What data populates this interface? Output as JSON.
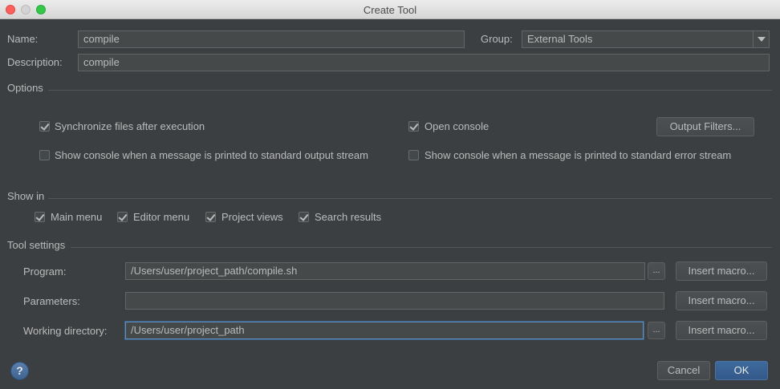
{
  "window": {
    "title": "Create Tool"
  },
  "form": {
    "name_label": "Name:",
    "name_value": "compile",
    "group_label": "Group:",
    "group_value": "External Tools",
    "description_label": "Description:",
    "description_value": "compile"
  },
  "options": {
    "title": "Options",
    "sync_files": {
      "label": "Synchronize files after execution",
      "checked": true
    },
    "open_console": {
      "label": "Open console",
      "checked": true
    },
    "output_filters_label": "Output Filters...",
    "show_console_stdout": {
      "label": "Show console when a message is printed to standard output stream",
      "checked": false
    },
    "show_console_stderr": {
      "label": "Show console when a message is printed to standard error stream",
      "checked": false
    }
  },
  "show_in": {
    "title": "Show in",
    "main_menu": {
      "label": "Main menu",
      "checked": true
    },
    "editor_menu": {
      "label": "Editor menu",
      "checked": true
    },
    "project_views": {
      "label": "Project views",
      "checked": true
    },
    "search_results": {
      "label": "Search results",
      "checked": true
    }
  },
  "tool_settings": {
    "title": "Tool settings",
    "program_label": "Program:",
    "program_value": "/Users/user/project_path/compile.sh",
    "parameters_label": "Parameters:",
    "parameters_value": "",
    "working_dir_label": "Working directory:",
    "working_dir_value": "/Users/user/project_path",
    "browse_label": "...",
    "insert_macro_label": "Insert macro..."
  },
  "footer": {
    "help_label": "?",
    "cancel_label": "Cancel",
    "ok_label": "OK"
  },
  "colors": {
    "accent": "#3d6a9c",
    "background": "#3c3f41",
    "field": "#45494a"
  }
}
